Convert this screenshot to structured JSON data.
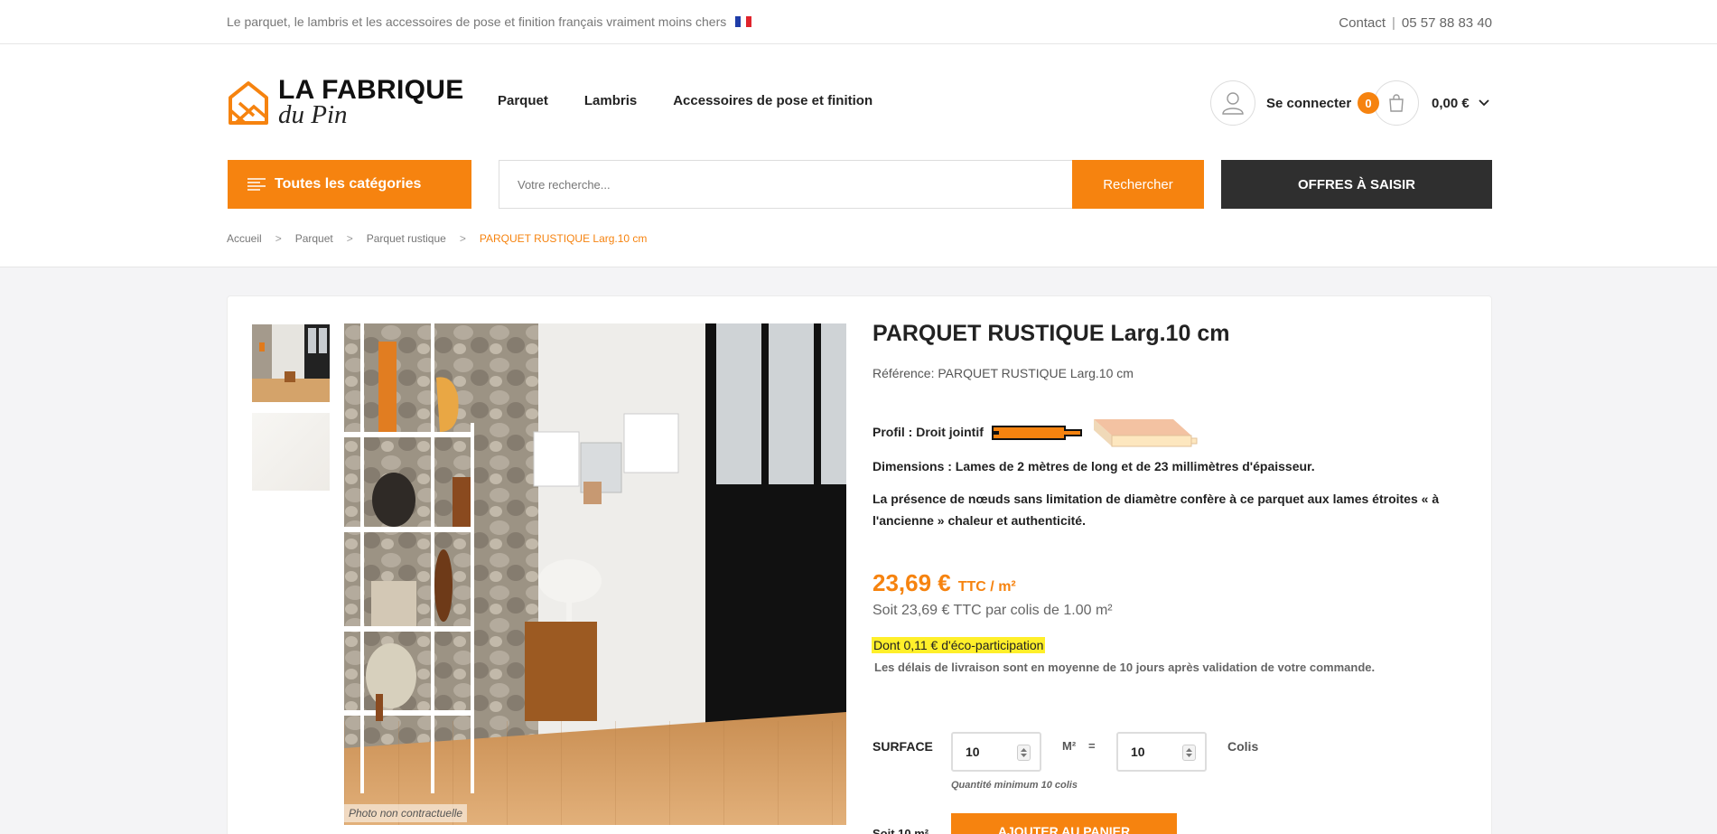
{
  "topbar": {
    "tagline": "Le parquet, le lambris et les accessoires de pose et finition français vraiment moins chers",
    "contact_label": "Contact",
    "separator": "|",
    "phone": "05 57 88 83 40"
  },
  "logo": {
    "line1": "LA FABRIQUE",
    "line2": "du Pin"
  },
  "nav": {
    "items": [
      "Parquet",
      "Lambris",
      "Accessoires de pose et finition"
    ]
  },
  "account": {
    "login_label": "Se connecter"
  },
  "cart": {
    "count": "0",
    "total": "0,00 €"
  },
  "categories_button": "Toutes les catégories",
  "search": {
    "placeholder": "Votre recherche...",
    "button_label": "Rechercher"
  },
  "offers_button": "OFFRES À SAISIR",
  "breadcrumb": {
    "items": [
      "Accueil",
      "Parquet",
      "Parquet rustique"
    ],
    "current": "PARQUET RUSTIQUE Larg.10 cm",
    "separator": ">"
  },
  "product": {
    "title": "PARQUET RUSTIQUE Larg.10 cm",
    "reference": "Référence: PARQUET RUSTIQUE Larg.10 cm",
    "profil": "Profil : Droit jointif",
    "dimensions": "Dimensions : Lames de 2 mètres de long et de 23 millimètres d'épaisseur.",
    "description": "La présence de nœuds sans limitation de diamètre confère à ce parquet aux lames étroites « à l'ancienne » chaleur et authenticité.",
    "image_caption": "Photo non contractuelle",
    "price": "23,69 €",
    "price_unit": "TTC / m²",
    "per_pack": "Soit 23,69 € TTC par colis de 1.00 m²",
    "eco_participation": "Dont 0,11 € d'éco-participation",
    "delivery_note": "Les délais de livraison sont en moyenne de 10 jours après validation de votre commande."
  },
  "quantity": {
    "surface_label": "SURFACE",
    "surface_value": "10",
    "m2_label": "M²",
    "equals": "=",
    "colis_value": "10",
    "colis_label": "Colis",
    "minimum_note": "Quantité minimum 10 colis",
    "subtotal_partial": "Soit 10 m²",
    "add_to_cart_partial": "AJOUTER AU PANIER"
  },
  "colors": {
    "accent": "#f6830f",
    "dark": "#2f2f2f",
    "highlight": "#ffef2a"
  }
}
